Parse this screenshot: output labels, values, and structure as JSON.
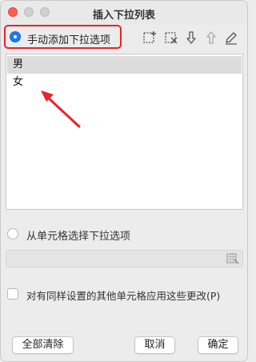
{
  "window": {
    "title": "插入下拉列表"
  },
  "manual_option": {
    "label": "手动添加下拉选项",
    "selected": true
  },
  "toolbar": {
    "icons": [
      "add-item-icon",
      "delete-item-icon",
      "move-down-icon",
      "move-up-icon",
      "edit-icon"
    ]
  },
  "list": {
    "items": [
      {
        "text": "男",
        "selected": true
      },
      {
        "text": "女",
        "selected": false
      }
    ]
  },
  "from_cell_option": {
    "label": "从单元格选择下拉选项",
    "selected": false
  },
  "range_input": {
    "value": "",
    "picker_icon": "range-select-icon"
  },
  "apply_checkbox": {
    "label": "对有同样设置的其他单元格应用这些更改(P)",
    "checked": false
  },
  "buttons": {
    "clear_all": "全部清除",
    "cancel": "取消",
    "ok": "确定"
  },
  "colors": {
    "accent": "#1a7cf4",
    "highlight": "#e8232c"
  }
}
